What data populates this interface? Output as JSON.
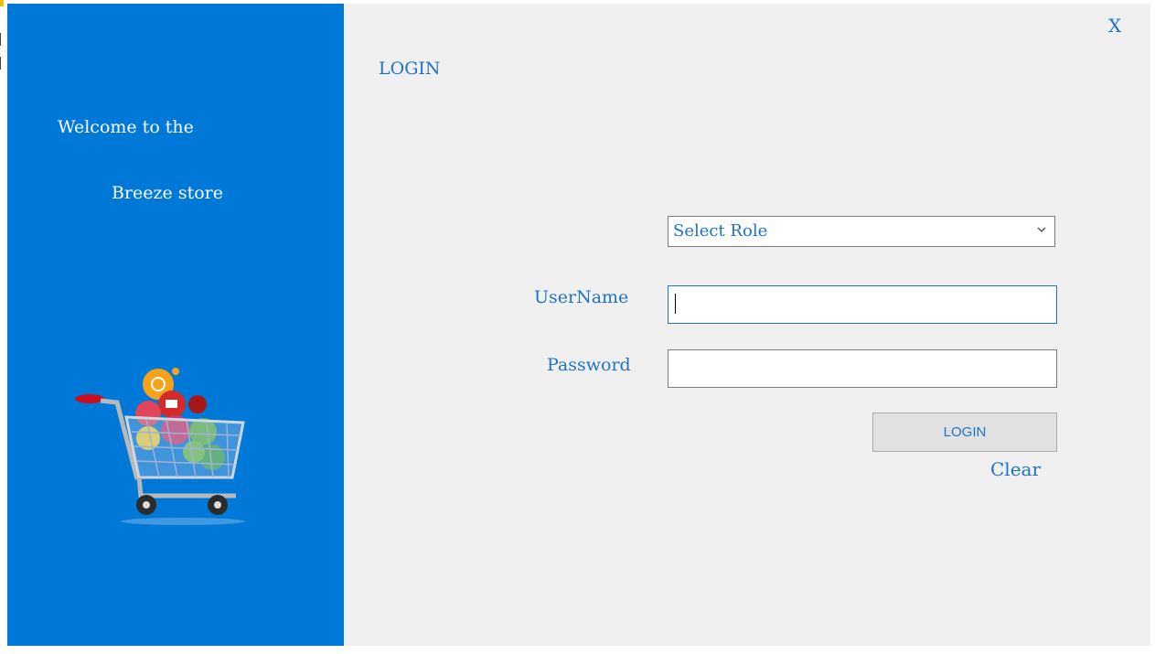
{
  "welcome_panel": {
    "line1": "Welcome to the",
    "line2": "Breeze store",
    "background": "#0078d7",
    "illustration": "shopping-cart-icon"
  },
  "form": {
    "close_label": "X",
    "title": "LOGIN",
    "role_select": {
      "selected": "Select Role"
    },
    "username_label": "UserName",
    "username_value": "",
    "password_label": "Password",
    "password_value": "",
    "login_button": "LOGIN",
    "clear_link": "Clear"
  },
  "colors": {
    "accent_text": "#1e73c8",
    "form_background": "#f0f0f0",
    "button_background": "#e1e1e1"
  }
}
